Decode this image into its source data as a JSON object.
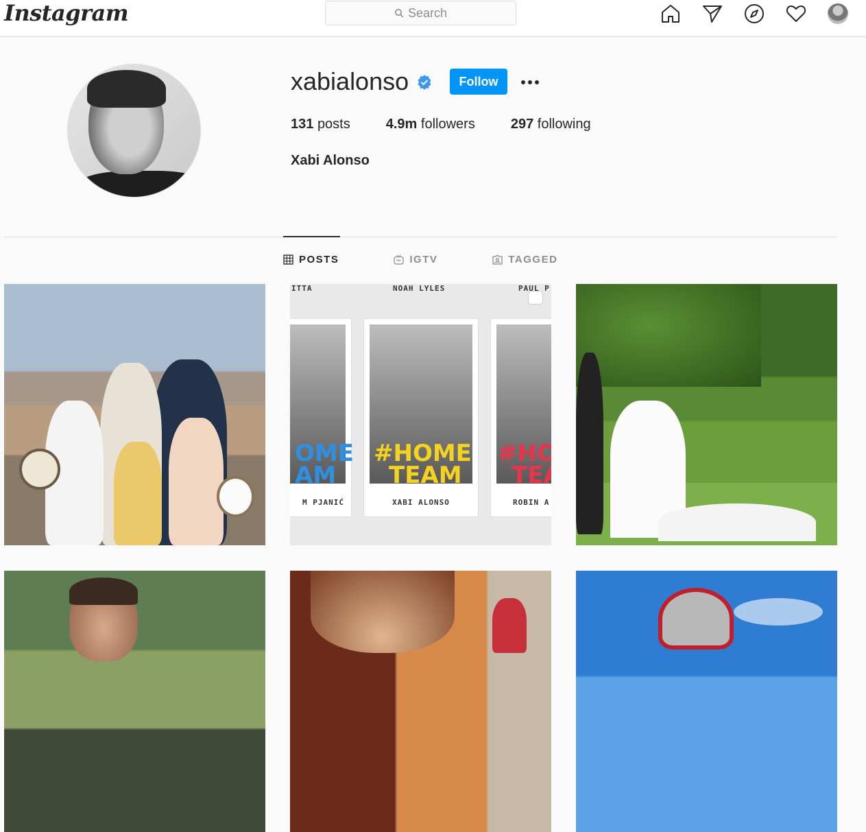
{
  "header": {
    "logo_text": "Instagram",
    "search_placeholder": "Search",
    "icons": [
      "home-icon",
      "direct-icon",
      "explore-icon",
      "activity-icon",
      "profile-avatar"
    ]
  },
  "profile": {
    "username": "xabialonso",
    "verified": true,
    "follow_label": "Follow",
    "stats": [
      {
        "value": "131",
        "label": "posts"
      },
      {
        "value": "4.9m",
        "label": "followers"
      },
      {
        "value": "297",
        "label": "following"
      }
    ],
    "full_name": "Xabi Alonso"
  },
  "tabs": [
    {
      "label": "POSTS",
      "icon": "grid-icon",
      "active": true
    },
    {
      "label": "IGTV",
      "icon": "igtv-icon",
      "active": false
    },
    {
      "label": "TAGGED",
      "icon": "tagged-icon",
      "active": false
    }
  ],
  "post2": {
    "top_names": [
      "ITTA",
      "NOAH LYLES",
      "PAUL P"
    ],
    "cards": [
      {
        "tag_line1": "OME",
        "tag_line2": "AM",
        "name": "M PJANIĆ"
      },
      {
        "tag_line1": "#HOME",
        "tag_line2": "TEAM",
        "name": "XABI ALONSO"
      },
      {
        "tag_line1": "#HO",
        "tag_line2": "TEA",
        "name": "ROBIN A"
      }
    ]
  },
  "colors": {
    "accent": "#0095f6",
    "verified": "#3897f0",
    "border": "#dbdbdb",
    "text": "#262626",
    "muted": "#8e8e8e"
  }
}
